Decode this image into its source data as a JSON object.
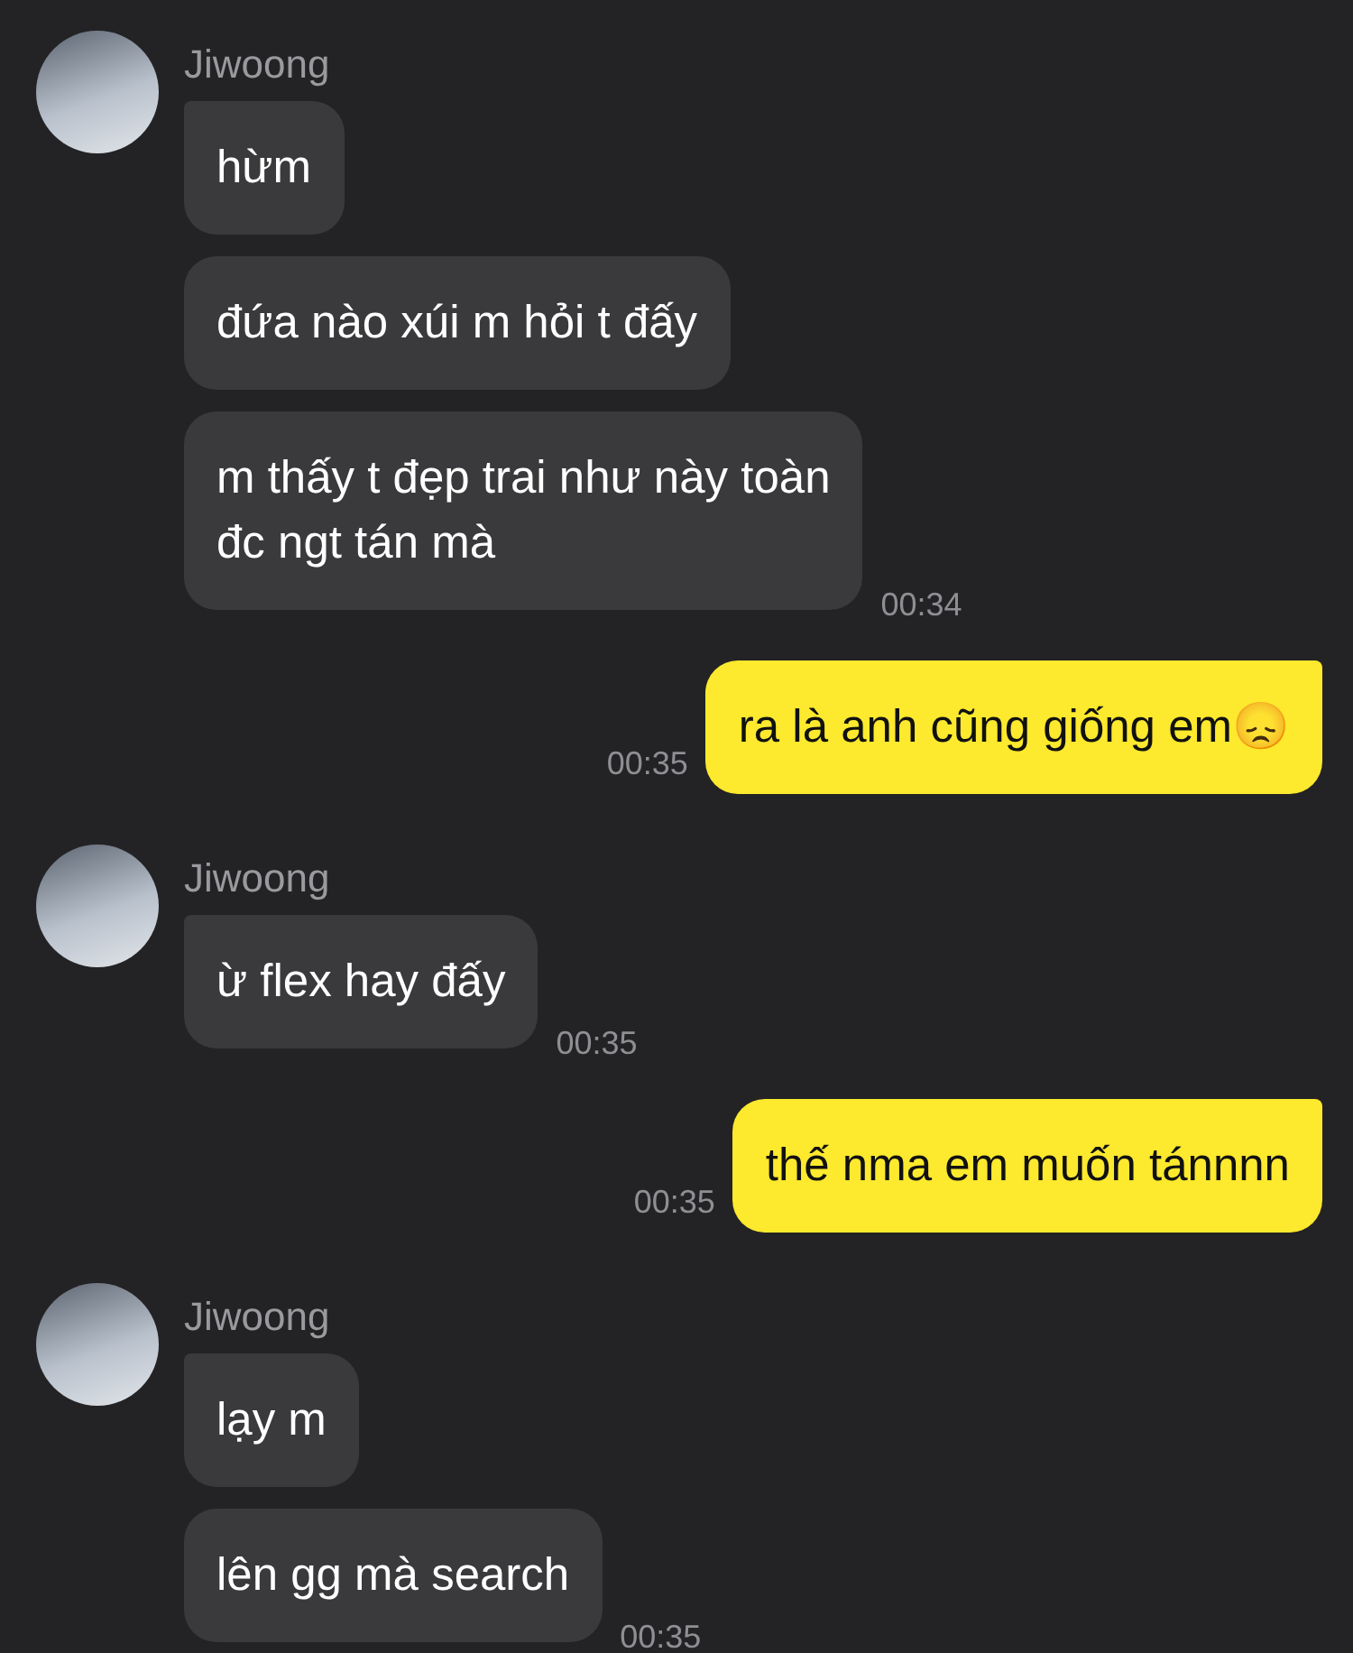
{
  "messages": [
    {
      "kind": "incoming",
      "sender": "Jiwoong",
      "bubbles": [
        {
          "text": "hừm"
        },
        {
          "text": "đứa nào xúi m hỏi t đấy"
        },
        {
          "text": "m thấy t đẹp trai như này toàn\nđc ngt tán mà",
          "time": "00:34"
        }
      ]
    },
    {
      "kind": "outgoing",
      "bubbles": [
        {
          "text": "ra là anh cũng giống em😞",
          "time": "00:35"
        }
      ]
    },
    {
      "kind": "incoming",
      "sender": "Jiwoong",
      "bubbles": [
        {
          "text": "ừ flex hay đấy",
          "time": "00:35"
        }
      ]
    },
    {
      "kind": "outgoing",
      "bubbles": [
        {
          "text": "thế nma em muốn tánnnn",
          "time": "00:35"
        }
      ]
    },
    {
      "kind": "incoming",
      "sender": "Jiwoong",
      "bubbles": [
        {
          "text": "lạy m"
        },
        {
          "text": "lên gg mà search",
          "time": "00:35"
        }
      ]
    }
  ]
}
